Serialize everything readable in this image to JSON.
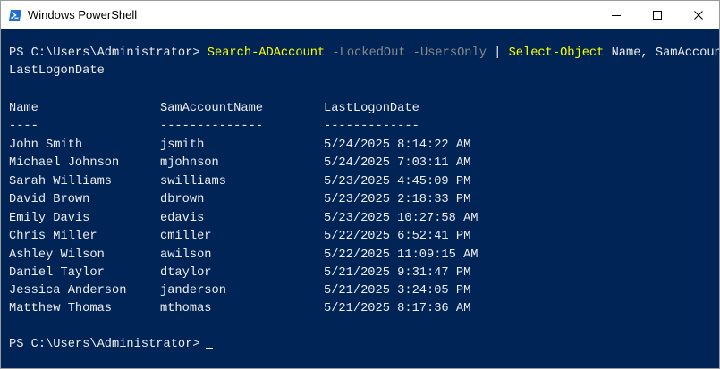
{
  "window": {
    "title": "Windows PowerShell",
    "icon": "powershell-icon",
    "controls": [
      "minimize-icon",
      "maximize-icon",
      "close-icon"
    ]
  },
  "console": {
    "prompt": "PS C:\\Users\\Administrator>",
    "command": {
      "cmdlet1": "Search-ADAccount",
      "param1": "-LockedOut",
      "param2": "-UsersOnly",
      "pipe": "|",
      "cmdlet2": "Select-Object",
      "args": "Name, SamAccountName,",
      "args_wrap": "LastLogonDate"
    },
    "headers": [
      "Name",
      "SamAccountName",
      "LastLogonDate"
    ],
    "separators": [
      "----",
      "--------------",
      "-------------"
    ],
    "rows": [
      [
        "John Smith",
        "jsmith",
        "5/24/2025 8:14:22 AM"
      ],
      [
        "Michael Johnson",
        "mjohnson",
        "5/24/2025 7:03:11 AM"
      ],
      [
        "Sarah Williams",
        "swilliams",
        "5/23/2025 4:45:09 PM"
      ],
      [
        "David Brown",
        "dbrown",
        "5/23/2025 2:18:33 PM"
      ],
      [
        "Emily Davis",
        "edavis",
        "5/23/2025 10:27:58 AM"
      ],
      [
        "Chris Miller",
        "cmiller",
        "5/22/2025 6:52:41 PM"
      ],
      [
        "Ashley Wilson",
        "awilson",
        "5/22/2025 11:09:15 AM"
      ],
      [
        "Daniel Taylor",
        "dtaylor",
        "5/21/2025 9:31:47 PM"
      ],
      [
        "Jessica Anderson",
        "janderson",
        "5/21/2025 3:24:05 PM"
      ],
      [
        "Matthew Thomas",
        "mthomas",
        "5/21/2025 8:17:36 AM"
      ]
    ],
    "final_prompt": "PS C:\\Users\\Administrator>"
  },
  "colors": {
    "background": "#012456",
    "text": "#eeedf0",
    "cmdlet": "#ffff00",
    "parameter": "#8a8a8a"
  }
}
